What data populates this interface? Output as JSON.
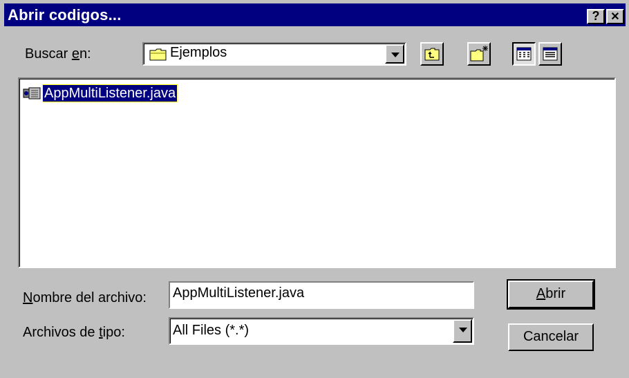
{
  "window": {
    "title": "Abrir codigos...",
    "help_label": "?",
    "close_label": "✕"
  },
  "lookin": {
    "label_pre": "Buscar ",
    "label_accel": "e",
    "label_post": "n:",
    "current_folder": "Ejemplos"
  },
  "toolbar": {
    "buttons": [
      "up-one-level",
      "create-new-folder",
      "list-view",
      "details-view"
    ]
  },
  "files": [
    {
      "name": "AppMultiListener.java",
      "selected": true
    }
  ],
  "filename": {
    "label_accel": "N",
    "label_rest": "ombre del archivo:",
    "value": "AppMultiListener.java"
  },
  "filetype": {
    "label_pre": "Archivos de ",
    "label_accel": "t",
    "label_post": "ipo:",
    "value": "All Files (*.*)"
  },
  "buttons": {
    "open_accel": "A",
    "open_rest": "brir",
    "cancel": "Cancelar"
  }
}
